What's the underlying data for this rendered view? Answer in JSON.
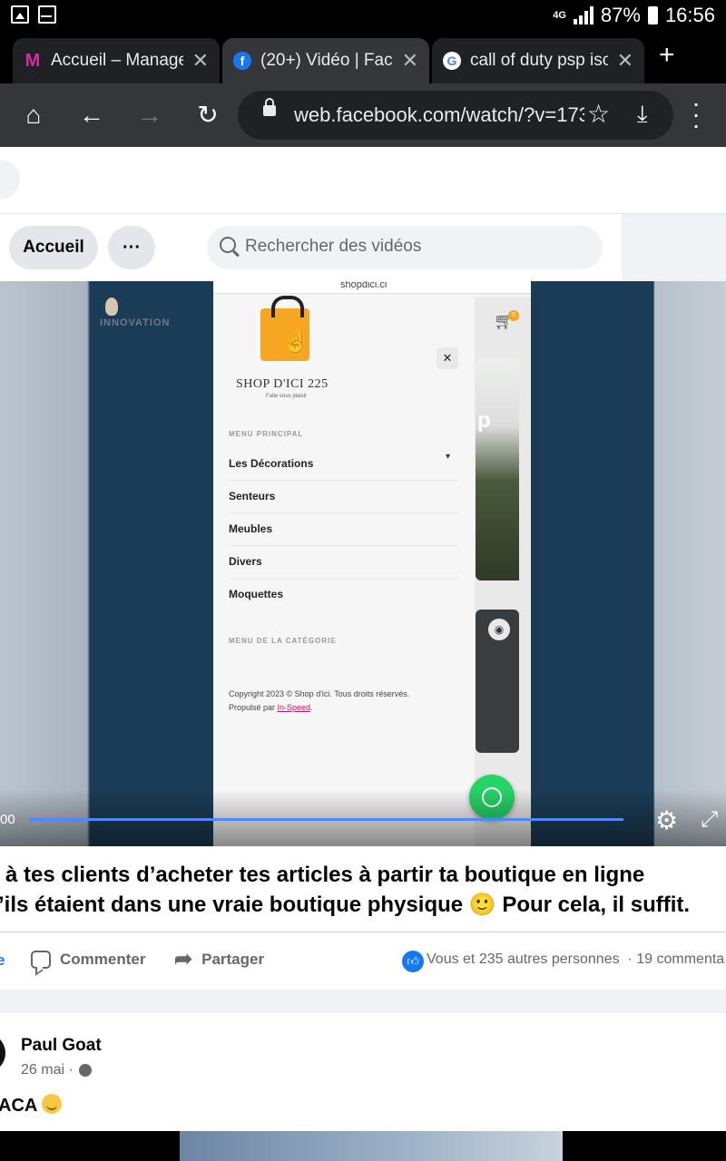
{
  "status_bar": {
    "network": "4G",
    "battery": "87%",
    "time": "16:56"
  },
  "tabs": [
    {
      "title": "Accueil – ManageM",
      "favicon": "managem-icon"
    },
    {
      "title": "(20+) Vidéo | Faceb",
      "favicon": "facebook-icon"
    },
    {
      "title": "call of duty psp iso",
      "favicon": "google-icon"
    }
  ],
  "toolbar": {
    "url": "web.facebook.com/watch/?v=173"
  },
  "watch_nav": {
    "home_label": "Accueil",
    "more_label": "···",
    "search_placeholder": "Rechercher des vidéos"
  },
  "video": {
    "phone_url": "shopdici.ci",
    "brand_overlay": "INNOVATION",
    "shop_name": "SHOP D'ICI 225",
    "shop_tagline": "Faite vous plaisir",
    "menu_heading": "MENU PRINCIPAL",
    "menu_items": [
      "Les Décorations",
      "Senteurs",
      "Meubles",
      "Divers",
      "Moquettes"
    ],
    "category_heading": "MENU DE LA CATÉGORIE",
    "copyright_line1": "Copyright 2023 © Shop d'ici. Tous droits réservés.",
    "copyright_line2_prefix": "Propulsé par ",
    "copyright_link": "In-Speed",
    "copyright_suffix": ".",
    "cart_count": "0",
    "card_text": "p",
    "time": "00",
    "progress": 1.0
  },
  "post": {
    "line1": "à tes clients d’acheter tes articles à partir ta boutique en ligne",
    "line2": "’ils étaient dans une vraie boutique physique 🙂 Pour cela, il suffit.",
    "like_partial": "e",
    "comment_label": "Commenter",
    "share_label": "Partager",
    "reactions_text": "Vous et 235 autres personnes",
    "comments_count": "· 19 commenta"
  },
  "comment": {
    "author": "Paul Goat",
    "date": "26 mai ·",
    "text": "ACA"
  },
  "colors": {
    "facebook_blue": "#1877f2",
    "whatsapp_green": "#25d366",
    "video_navy": "#1b3c57"
  }
}
